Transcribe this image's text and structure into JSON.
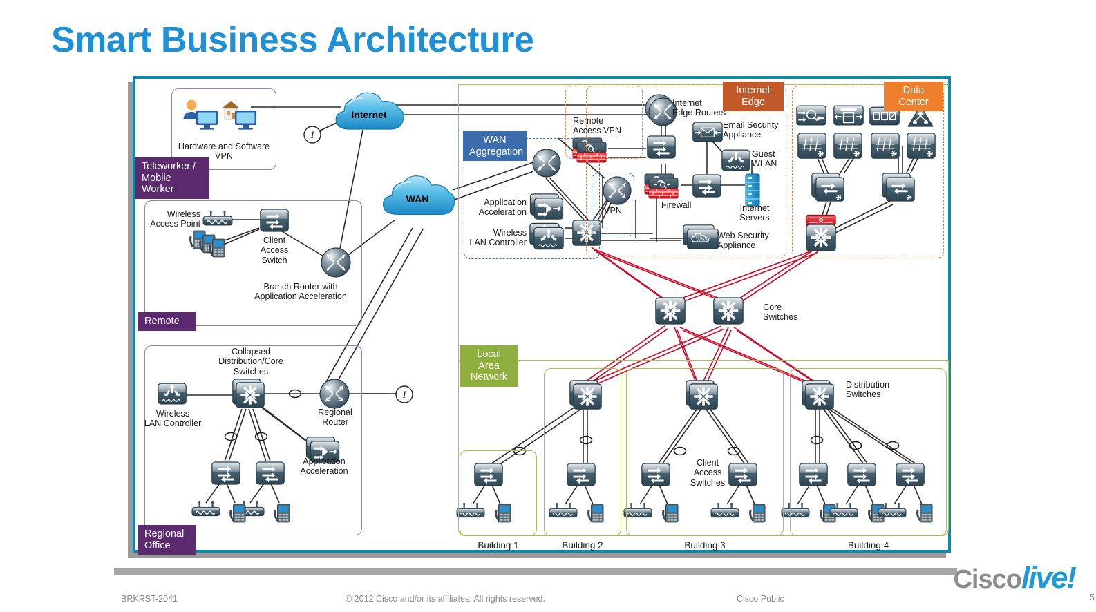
{
  "slide": {
    "title": "Smart Business Architecture"
  },
  "footer": {
    "session_id": "BRKRST-2041",
    "copyright": "© 2012 Cisco and/or its affiliates. All rights reserved.",
    "classification": "Cisco Public",
    "brand_cisco": "Cisco",
    "brand_live": "live!",
    "page_number": "5"
  },
  "colors": {
    "frame_border": "#0d8aa8",
    "title_blue": "#1f8fd6",
    "zone_purple": "#5c2a6e",
    "zone_purple_border": "#9b7fb5",
    "zone_blue": "#3b6cab",
    "zone_green": "#8fb03e",
    "zone_green_border": "#a8c04f",
    "zone_brown": "#c15a28",
    "zone_orange": "#f07f2d",
    "link_black": "#1a1a1a",
    "link_red": "#c8102e",
    "device_dark": "#3b5563",
    "device_light": "#cfd8dd",
    "firewall_red": "#e11b22",
    "cloud_blue": "#2aa3d6"
  },
  "zones": [
    {
      "id": "teleworker",
      "label": "Teleworker /\nMobile Worker",
      "style": "purple"
    },
    {
      "id": "remote",
      "label": "Remote",
      "style": "purple"
    },
    {
      "id": "regional",
      "label": "Regional\nOffice",
      "style": "purple"
    },
    {
      "id": "wan_agg",
      "label": "WAN\nAggregation",
      "style": "blue"
    },
    {
      "id": "lan",
      "label": "Local Area\nNetwork",
      "style": "green"
    },
    {
      "id": "internet_edge",
      "label": "Internet\nEdge",
      "style": "brown"
    },
    {
      "id": "data_center",
      "label": "Data\nCenter",
      "style": "orange"
    }
  ],
  "clouds": [
    {
      "id": "internet",
      "label": "Internet"
    },
    {
      "id": "wan",
      "label": "WAN"
    }
  ],
  "device_labels": {
    "hw_sw_vpn": "Hardware and Software\nVPN",
    "wireless_ap": "Wireless\nAccess Point",
    "client_access_switch_remote": "Client\nAccess\nSwitch",
    "branch_router": "Branch Router with\nApplication Acceleration",
    "collapsed_dist_core": "Collapsed\nDistribution/Core\nSwitches",
    "wlc_regional": "Wireless\nLAN Controller",
    "regional_router": "Regional\nRouter",
    "app_accel_regional": "Application\nAcceleration",
    "app_accel_wan": "Application\nAcceleration",
    "wlc_wan": "Wireless\nLAN Controller",
    "remote_access_vpn": "Remote\nAccess VPN",
    "vpn": "VPN",
    "firewall": "Firewall",
    "internet_edge_routers": "Internet\nEdge Routers",
    "email_security": "Email Security\nAppliance",
    "guest_wlan": "Guest\nWLAN",
    "internet_servers": "Internet\nServers",
    "web_security": "Web Security\nAppliance",
    "core_switches": "Core\nSwitches",
    "distribution_switches": "Distribution\nSwitches",
    "client_access_switches": "Client\nAccess\nSwitches"
  },
  "buildings": [
    {
      "name": "Building 1",
      "access_switches": 1
    },
    {
      "name": "Building 2",
      "access_switches": 1
    },
    {
      "name": "Building 3",
      "access_switches": 2
    },
    {
      "name": "Building 4",
      "access_switches": 3
    }
  ]
}
